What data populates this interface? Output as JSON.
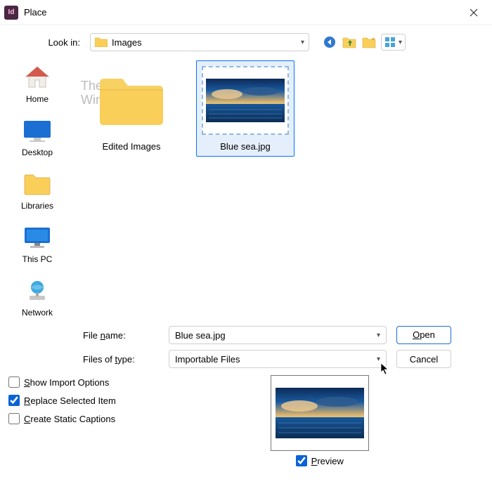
{
  "titlebar": {
    "title": "Place"
  },
  "lookin": {
    "label": "Look in:",
    "value": "Images"
  },
  "toolbar": {
    "back": "back",
    "up": "up",
    "new_folder": "new-folder",
    "views": "views"
  },
  "sidebar": {
    "items": [
      {
        "label": "Home"
      },
      {
        "label": "Desktop"
      },
      {
        "label": "Libraries"
      },
      {
        "label": "This PC"
      },
      {
        "label": "Network"
      }
    ]
  },
  "files": {
    "items": [
      {
        "label": "Edited Images",
        "type": "folder"
      },
      {
        "label": "Blue sea.jpg",
        "type": "image",
        "selected": true
      }
    ]
  },
  "watermark": {
    "line1": "The",
    "line2": "WindowsClub"
  },
  "form": {
    "filename_label": "File name:",
    "filename_value": "Blue sea.jpg",
    "filetype_label": "Files of type:",
    "filetype_value": "Importable Files",
    "open_label": "Open",
    "cancel_label": "Cancel"
  },
  "options": {
    "show_import": "Show Import Options",
    "replace_selected": "Replace Selected Item",
    "create_captions": "Create Static Captions",
    "preview_label": "Preview"
  }
}
